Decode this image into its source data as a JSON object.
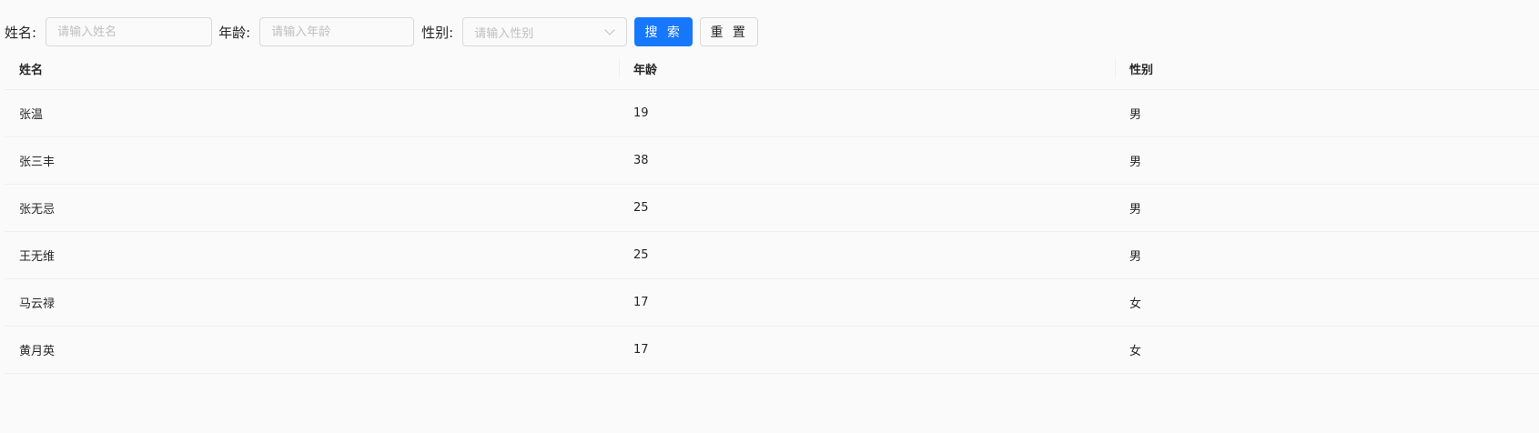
{
  "search": {
    "name_label": "姓名:",
    "name_placeholder": "请输入姓名",
    "name_value": "",
    "age_label": "年龄:",
    "age_placeholder": "请输入年龄",
    "age_value": "",
    "gender_label": "性别:",
    "gender_placeholder": "请输入性别",
    "search_button": "搜 索",
    "reset_button": "重 置",
    "primary_color": "#1677ff"
  },
  "table": {
    "columns": [
      "姓名",
      "年龄",
      "性别"
    ],
    "rows": [
      [
        "张温",
        "19",
        "男"
      ],
      [
        "张三丰",
        "38",
        "男"
      ],
      [
        "张无忌",
        "25",
        "男"
      ],
      [
        "王无维",
        "25",
        "男"
      ],
      [
        "马云禄",
        "17",
        "女"
      ],
      [
        "黄月英",
        "17",
        "女"
      ]
    ]
  }
}
